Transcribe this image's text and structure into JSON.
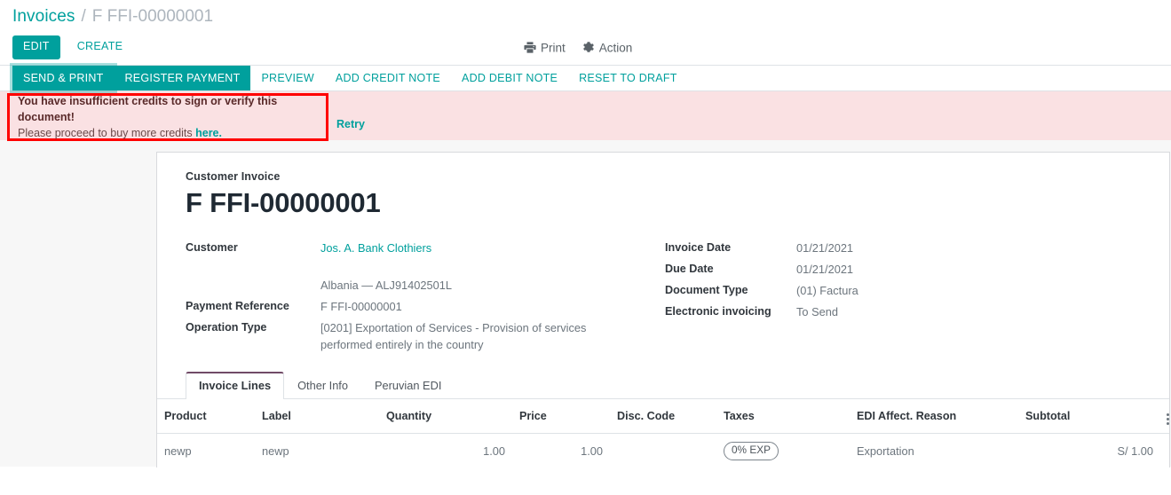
{
  "breadcrumb": {
    "root": "Invoices",
    "separator": "/",
    "current": "F FFI-00000001"
  },
  "control_panel": {
    "edit_label": "EDIT",
    "create_label": "CREATE",
    "print_label": "Print",
    "print_icon": "printer-icon",
    "action_label": "Action",
    "action_icon": "gear-icon"
  },
  "statusbar": {
    "buttons": [
      {
        "label": "SEND & PRINT",
        "style": "primary",
        "focused": true
      },
      {
        "label": "REGISTER PAYMENT",
        "style": "primary",
        "focused": false
      },
      {
        "label": "PREVIEW",
        "style": "link",
        "focused": false
      },
      {
        "label": "ADD CREDIT NOTE",
        "style": "link",
        "focused": false
      },
      {
        "label": "ADD DEBIT NOTE",
        "style": "link",
        "focused": false
      },
      {
        "label": "RESET TO DRAFT",
        "style": "link",
        "focused": false
      }
    ]
  },
  "alert": {
    "title": "You have insufficient credits to sign or verify this document!",
    "body_prefix": "Please proceed to buy more credits ",
    "link_text": "here.",
    "retry_label": "Retry",
    "background_color": "#fae1e3",
    "highlight_border_color": "#ff0000"
  },
  "invoice": {
    "type_label": "Customer Invoice",
    "number": "F FFI-00000001",
    "left_fields": [
      {
        "label": "Customer",
        "value": "Jos. A. Bank Clothiers",
        "is_link": true
      },
      {
        "label": "",
        "value": "Albania — ALJ91402501L",
        "is_link": false
      },
      {
        "label": "Payment Reference",
        "value": "F FFI-00000001",
        "is_link": false
      },
      {
        "label": "Operation Type",
        "value": "[0201] Exportation of Services - Provision of services performed entirely in the country",
        "is_link": false
      }
    ],
    "right_fields": [
      {
        "label": "Invoice Date",
        "value": "01/21/2021"
      },
      {
        "label": "Due Date",
        "value": "01/21/2021"
      },
      {
        "label": "Document Type",
        "value": "(01) Factura"
      },
      {
        "label": "Electronic invoicing",
        "value": "To Send"
      }
    ]
  },
  "tabs": [
    {
      "label": "Invoice Lines",
      "active": true
    },
    {
      "label": "Other Info",
      "active": false
    },
    {
      "label": "Peruvian EDI",
      "active": false
    }
  ],
  "lines": {
    "columns": [
      {
        "label": "Product",
        "align": "left"
      },
      {
        "label": "Label",
        "align": "left"
      },
      {
        "label": "Quantity",
        "align": "right"
      },
      {
        "label": "Price",
        "align": "right"
      },
      {
        "label": "Disc. Code",
        "align": "left"
      },
      {
        "label": "Taxes",
        "align": "left"
      },
      {
        "label": "EDI Affect. Reason",
        "align": "left"
      },
      {
        "label": "Subtotal",
        "align": "right"
      }
    ],
    "optional_columns_icon": "kebab-menu-icon",
    "rows": [
      {
        "product": "newp",
        "label": "newp",
        "quantity": "1.00",
        "price": "1.00",
        "disc_code": "",
        "taxes": "0% EXP",
        "edi_affect_reason": "Exportation",
        "subtotal": "S/ 1.00"
      }
    ]
  },
  "theme": {
    "accent": "#00A09D",
    "tab_accent": "#714B67",
    "page_background": "#f7f7f7"
  }
}
